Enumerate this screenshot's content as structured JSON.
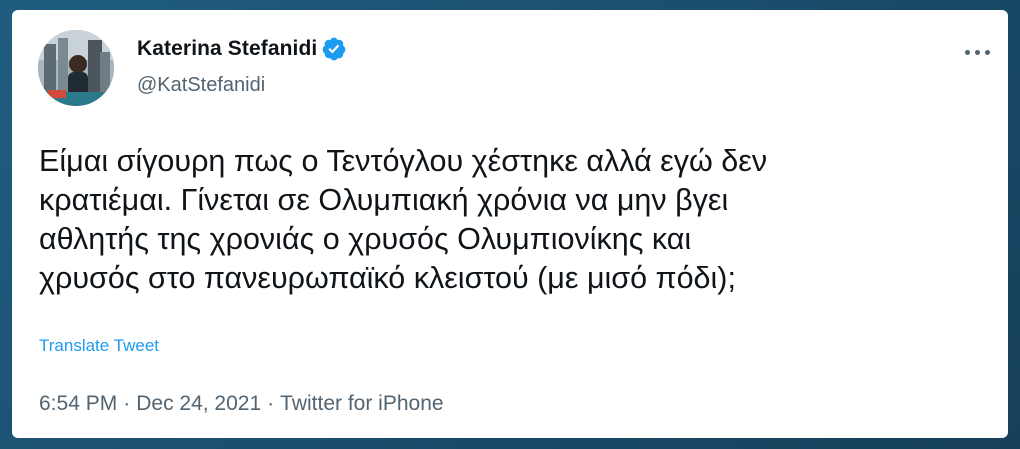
{
  "author": {
    "display_name": "Katerina Stefanidi",
    "handle": "@KatStefanidi",
    "verified": true,
    "verified_color": "#1d9bf0",
    "avatar_icon": "profile-photo"
  },
  "tweet": {
    "lines": [
      "Είμαι σίγουρη πως ο Τεντόγλου χέστηκε αλλά εγώ δεν",
      "κρατιέμαι. Γίνεται σε Ολυμπιακή χρόνια να μην βγει",
      "αθλητής της χρονιάς ο χρυσός Ολυμπιονίκης και",
      "χρυσός στο πανευρωπαϊκό κλειστού (με μισό πόδι);"
    ],
    "translate_label": "Translate Tweet"
  },
  "meta": {
    "time": "6:54 PM",
    "date": "Dec 24, 2021",
    "source": "Twitter for iPhone",
    "separator": "·"
  },
  "colors": {
    "text": "#0f1419",
    "secondary": "#536471",
    "link": "#1d9bf0",
    "background": "#ffffff"
  }
}
